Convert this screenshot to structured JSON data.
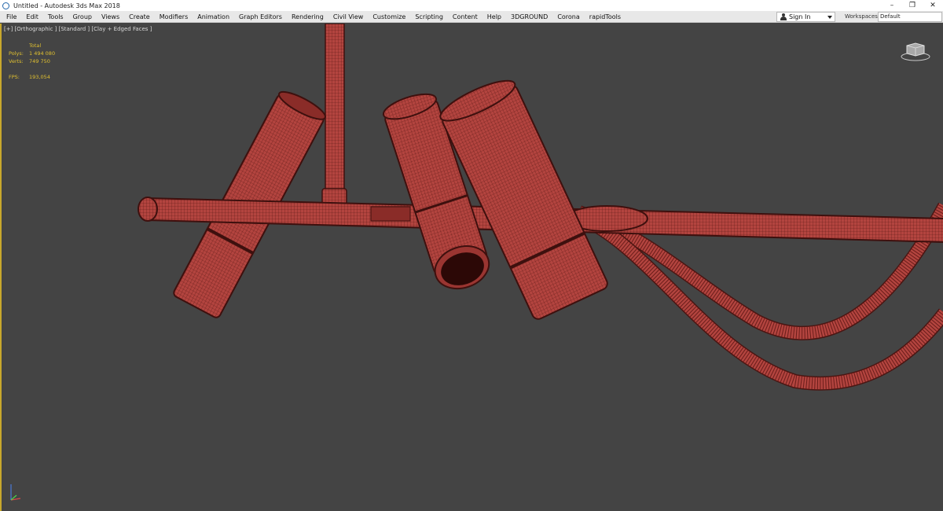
{
  "window": {
    "title": "Untitled - Autodesk 3ds Max 2018",
    "controls": {
      "minimize": "–",
      "restore": "❐",
      "close": "✕"
    }
  },
  "menu": {
    "items": [
      "File",
      "Edit",
      "Tools",
      "Group",
      "Views",
      "Create",
      "Modifiers",
      "Animation",
      "Graph Editors",
      "Rendering",
      "Civil View",
      "Customize",
      "Scripting",
      "Content",
      "Help",
      "3DGROUND",
      "Corona",
      "rapidTools"
    ],
    "signin_label": "Sign In",
    "workspaces_label": "Workspaces:",
    "workspaces_value": "Default"
  },
  "viewport": {
    "label": "[+] [Orthographic ] [Standard ] [Clay + Edged Faces ]",
    "stats": {
      "total_label": "Total",
      "polys_label": "Polys:",
      "polys_value": "1 494 080",
      "verts_label": "Verts:",
      "verts_value": "749 750",
      "fps_label": "FPS:",
      "fps_value": "193,054"
    },
    "accent_color": "#c8a82c",
    "object_color": "#b0403e"
  },
  "icons": {
    "app": "3dsmax-logo-icon",
    "user": "user-icon",
    "viewcube": "viewcube-icon",
    "axis": "axis-tripod-icon"
  }
}
